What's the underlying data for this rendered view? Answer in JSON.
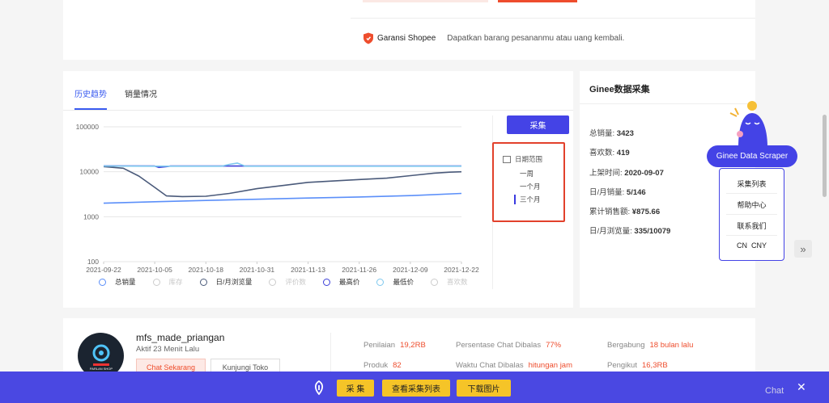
{
  "guarantee": {
    "title": "Garansi Shopee",
    "desc": "Dapatkan barang pesananmu atau uang kembali."
  },
  "tabs": [
    {
      "label": "历史趋势",
      "active": true
    },
    {
      "label": "销量情况",
      "active": false
    }
  ],
  "collect_button": "采集",
  "range": {
    "title": "日期范围",
    "options": [
      "一周",
      "一个月",
      "三个月"
    ],
    "selected": "三个月"
  },
  "legend": [
    {
      "label": "总销量",
      "color": "#5b8ff9",
      "active": true
    },
    {
      "label": "库存",
      "color": "#cccccc",
      "active": false
    },
    {
      "label": "日/月浏览量",
      "color": "#4a5a7a",
      "active": true
    },
    {
      "label": "评价数",
      "color": "#cccccc",
      "active": false
    },
    {
      "label": "最高价",
      "color": "#3b3fd8",
      "active": true
    },
    {
      "label": "最低价",
      "color": "#7ec8ee",
      "active": true
    },
    {
      "label": "喜欢数",
      "color": "#cccccc",
      "active": false
    }
  ],
  "chart_data": {
    "type": "line",
    "yscale": "log",
    "ylim": [
      100,
      100000
    ],
    "yticks": [
      "100000",
      "10000",
      "1000",
      "100"
    ],
    "xticks": [
      "2021-09-22",
      "2021-10-05",
      "2021-10-18",
      "2021-10-31",
      "2021-11-13",
      "2021-11-26",
      "2021-12-09",
      "2021-12-22"
    ],
    "series": [
      {
        "name": "总销量",
        "color": "#5b8ff9",
        "x": [
          0,
          13,
          26,
          39,
          52,
          65,
          78,
          91
        ],
        "y": [
          2000,
          2150,
          2300,
          2450,
          2600,
          2750,
          2950,
          3300
        ]
      },
      {
        "name": "日/月浏览量",
        "color": "#4a5a7a",
        "x": [
          0,
          5,
          9,
          13,
          16,
          20,
          26,
          32,
          39,
          46,
          52,
          58,
          65,
          72,
          78,
          84,
          88,
          91
        ],
        "y": [
          13000,
          12000,
          8000,
          4500,
          2900,
          2800,
          2850,
          3300,
          4200,
          5000,
          5800,
          6200,
          6700,
          7200,
          8200,
          9300,
          9800,
          10000
        ]
      },
      {
        "name": "最高价",
        "color": "#3b3fd8",
        "x": [
          0,
          13,
          14,
          16,
          17,
          30,
          39,
          52,
          65,
          78,
          91
        ],
        "y": [
          13500,
          13400,
          12500,
          13000,
          13400,
          13400,
          13400,
          13400,
          13400,
          13400,
          13400
        ]
      },
      {
        "name": "最低价",
        "color": "#7ec8ee",
        "x": [
          0,
          13,
          30,
          32,
          34,
          36,
          39,
          52,
          65,
          78,
          91
        ],
        "y": [
          13400,
          13300,
          13300,
          14600,
          15600,
          13300,
          13300,
          13300,
          13300,
          13300,
          13300
        ]
      }
    ]
  },
  "ginee": {
    "title": "Ginee数据采集",
    "stats": [
      {
        "label": "总销量:",
        "value": "3423"
      },
      {
        "label": "喜欢数:",
        "value": "419"
      },
      {
        "label": "上架时间:",
        "value": "2020-09-07"
      },
      {
        "label": "日/月销量:",
        "value": "5/146"
      },
      {
        "label": "累计销售额:",
        "value": "¥875.66"
      },
      {
        "label": "日/月浏览量:",
        "value": "335/10079"
      }
    ]
  },
  "scraper": {
    "badge": "Ginee Data Scraper",
    "menu": [
      "采集列表",
      "帮助中心",
      "联系我们",
      "CN  CNY"
    ]
  },
  "shop": {
    "name": "mfs_made_priangan",
    "active": "Aktif 23 Menit Lalu",
    "chat_button": "Chat Sekarang",
    "visit_button": "Kunjungi Toko",
    "avatar_text": "PARLAN SHOP",
    "metrics": [
      {
        "label": "Penilaian",
        "value": "19,2RB"
      },
      {
        "label": "Persentase Chat Dibalas",
        "value": "77%"
      },
      {
        "label": "Bergabung",
        "value": "18 bulan lalu"
      },
      {
        "label": "Produk",
        "value": "82"
      },
      {
        "label": "Waktu Chat Dibalas",
        "value": "hitungan jam"
      },
      {
        "label": "Pengikut",
        "value": "16,3RB"
      }
    ]
  },
  "bottom_bar": {
    "buttons": [
      "采 集",
      "查看采集列表",
      "下载图片"
    ],
    "close": "✕",
    "chat_peek": "Chat"
  }
}
